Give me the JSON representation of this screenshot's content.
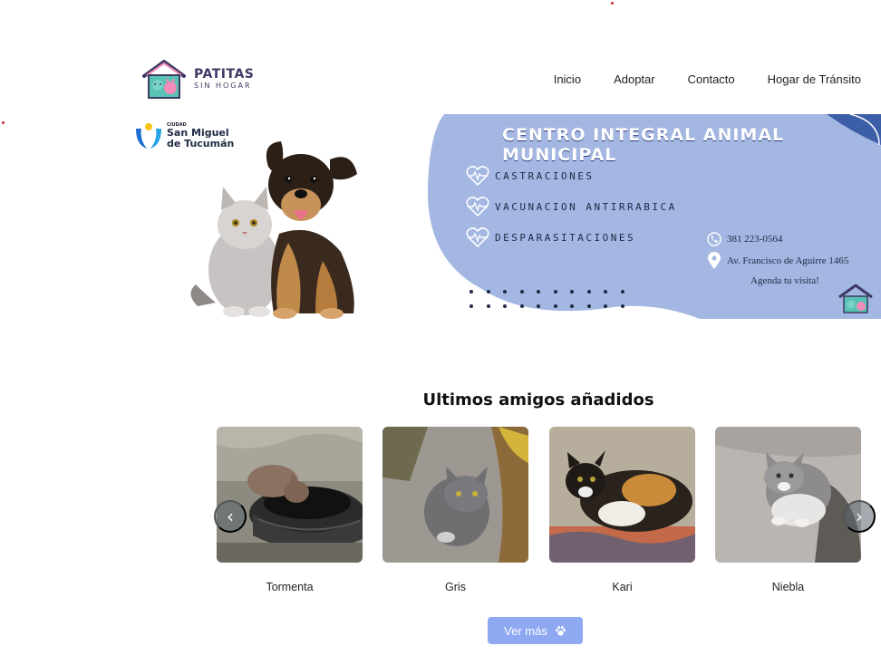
{
  "brand": {
    "name": "PATITAS",
    "tagline": "SIN HOGAR"
  },
  "nav": {
    "items": [
      "Inicio",
      "Adoptar",
      "Contacto",
      "Hogar de Tránsito"
    ]
  },
  "banner": {
    "city_small": "CIUDAD",
    "city_line1": "San Miguel",
    "city_line2": "de Tucumán",
    "title": "CENTRO INTEGRAL ANIMAL MUNICIPAL",
    "services": [
      "CASTRACIONES",
      "VACUNACION ANTIRRABICA",
      "DESPARASITACIONES"
    ],
    "phone": "381 223-0564",
    "address": "Av. Francisco de Aguirre 1465",
    "visit": "Agenda tu visita!"
  },
  "section": {
    "title": "Ultimos amigos añadidos"
  },
  "pets": [
    {
      "name": "Tormenta"
    },
    {
      "name": "Gris"
    },
    {
      "name": "Kari"
    },
    {
      "name": "Niebla"
    }
  ],
  "carousel": {
    "prev_icon": "chevron-left-icon",
    "next_icon": "chevron-right-icon"
  },
  "cta": {
    "label": "Ver más",
    "icon": "paw-icon"
  },
  "colors": {
    "accent": "#8ea8f2",
    "banner_blue": "#a3b7e2",
    "brand_dark": "#3d3a63",
    "brand_pink": "#f28cb8",
    "brand_teal": "#58c3b5"
  }
}
